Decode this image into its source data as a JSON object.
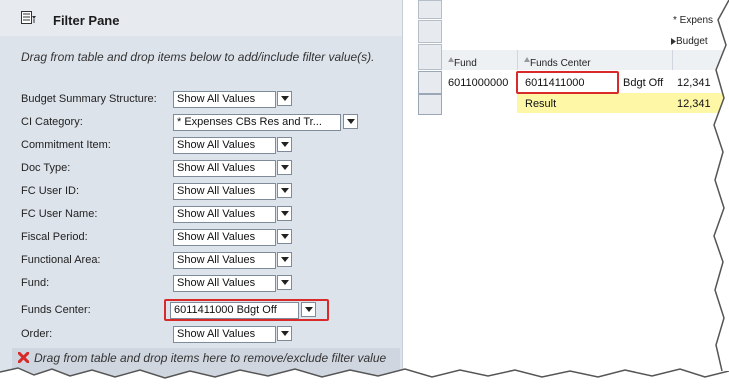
{
  "filter_pane": {
    "title": "Filter Pane",
    "icon": "filter-pane-icon",
    "instructions": "Drag from table and drop items below to add/include filter value(s).",
    "filters": [
      {
        "label": "Budget Summary Structure:",
        "value": "Show All Values"
      },
      {
        "label": "CI Category:",
        "value": "* Expenses CBs Res and Tr..."
      },
      {
        "label": "Commitment Item:",
        "value": "Show All Values"
      },
      {
        "label": "Doc Type:",
        "value": "Show All Values"
      },
      {
        "label": "FC User ID:",
        "value": "Show All Values"
      },
      {
        "label": "FC User Name:",
        "value": "Show All Values"
      },
      {
        "label": "Fiscal Period:",
        "value": "Show All Values"
      },
      {
        "label": "Functional Area:",
        "value": "Show All Values"
      },
      {
        "label": "Fund:",
        "value": "Show All Values"
      },
      {
        "label": "Funds Center:",
        "value": "6011411000 Bdgt Off"
      },
      {
        "label": "Order:",
        "value": "Show All Values"
      }
    ],
    "remove_zone_text": "Drag from table and drop items here to remove/exclude filter value"
  },
  "table": {
    "top_header_1": "* Expens",
    "top_header_2": "Budget",
    "columns": [
      "Fund",
      "Funds Center"
    ],
    "sort_icon": "sort-ascending-icon",
    "rows": [
      {
        "fund": "6011000000",
        "funds_center": "6011411000",
        "funds_center_text": "Bdgt Off",
        "value": "12,341"
      },
      {
        "fund": "",
        "funds_center": "Result",
        "funds_center_text": "",
        "value": "12,341"
      }
    ]
  },
  "colors": {
    "pane_bg": "#dde3eb",
    "highlight_red": "#d92a2a",
    "result_yellow": "#fdf7a6"
  }
}
